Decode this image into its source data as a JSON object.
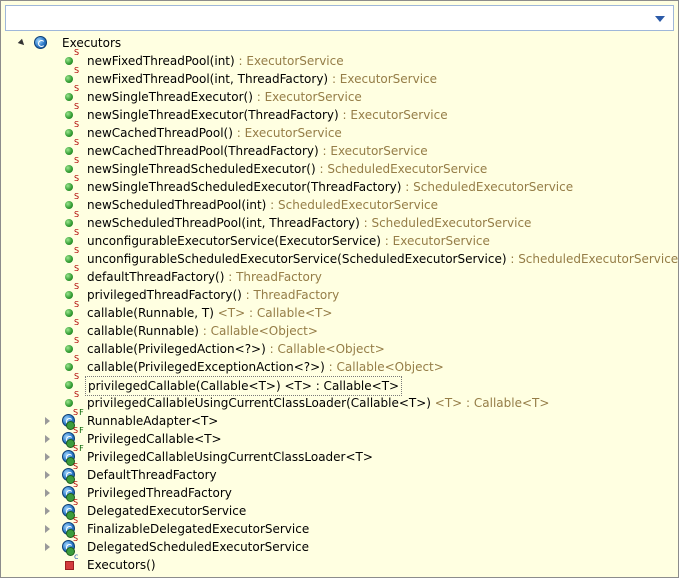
{
  "root": {
    "label": "Executors"
  },
  "methods": [
    {
      "sig": "newFixedThreadPool(int)",
      "ret": " : ExecutorService"
    },
    {
      "sig": "newFixedThreadPool(int, ThreadFactory)",
      "ret": " : ExecutorService"
    },
    {
      "sig": "newSingleThreadExecutor()",
      "ret": " : ExecutorService"
    },
    {
      "sig": "newSingleThreadExecutor(ThreadFactory)",
      "ret": " : ExecutorService"
    },
    {
      "sig": "newCachedThreadPool()",
      "ret": " : ExecutorService"
    },
    {
      "sig": "newCachedThreadPool(ThreadFactory)",
      "ret": " : ExecutorService"
    },
    {
      "sig": "newSingleThreadScheduledExecutor()",
      "ret": " : ScheduledExecutorService"
    },
    {
      "sig": "newSingleThreadScheduledExecutor(ThreadFactory)",
      "ret": " : ScheduledExecutorService"
    },
    {
      "sig": "newScheduledThreadPool(int)",
      "ret": " : ScheduledExecutorService"
    },
    {
      "sig": "newScheduledThreadPool(int, ThreadFactory)",
      "ret": " : ScheduledExecutorService"
    },
    {
      "sig": "unconfigurableExecutorService(ExecutorService)",
      "ret": " : ExecutorService"
    },
    {
      "sig": "unconfigurableScheduledExecutorService(ScheduledExecutorService)",
      "ret": " : ScheduledExecutorService"
    },
    {
      "sig": "defaultThreadFactory()",
      "ret": " : ThreadFactory"
    },
    {
      "sig": "privilegedThreadFactory()",
      "ret": " : ThreadFactory"
    },
    {
      "sig": "callable(Runnable, T)",
      "gen": " <T>",
      "ret": " : Callable<T>"
    },
    {
      "sig": "callable(Runnable)",
      "ret": " : Callable<Object>"
    },
    {
      "sig": "callable(PrivilegedAction<?>)",
      "ret": " : Callable<Object>"
    },
    {
      "sig": "callable(PrivilegedExceptionAction<?>)",
      "ret": " : Callable<Object>"
    },
    {
      "sig": "privilegedCallable(Callable<T>) <T> : Callable<T>",
      "ret": "",
      "selected": true
    },
    {
      "sig": "privilegedCallableUsingCurrentClassLoader(Callable<T>)",
      "gen": " <T>",
      "ret": " : Callable<T>"
    }
  ],
  "classes": [
    {
      "label": "RunnableAdapter<T>",
      "mods": "S",
      "final": "F"
    },
    {
      "label": "PrivilegedCallable<T>",
      "mods": "S",
      "final": "F"
    },
    {
      "label": "PrivilegedCallableUsingCurrentClassLoader<T>",
      "mods": "S",
      "final": "F"
    },
    {
      "label": "DefaultThreadFactory",
      "mods": "S",
      "final": ""
    },
    {
      "label": "PrivilegedThreadFactory",
      "mods": "S",
      "final": ""
    },
    {
      "label": "DelegatedExecutorService",
      "mods": "S",
      "final": ""
    },
    {
      "label": "FinalizableDelegatedExecutorService",
      "mods": "S",
      "final": ""
    },
    {
      "label": "DelegatedScheduledExecutorService",
      "mods": "S",
      "final": ""
    }
  ],
  "constructor": {
    "label": "Executors()",
    "mod": "c"
  },
  "modifier_static": "S",
  "colors": {
    "return_type": "#957d47",
    "background": "#ffffe1",
    "static_mod": "#b00000"
  }
}
